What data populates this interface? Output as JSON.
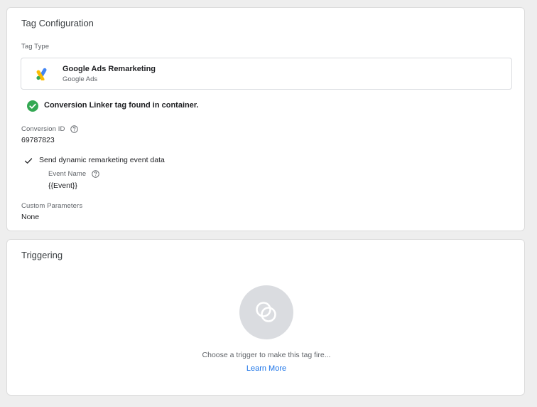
{
  "tag_configuration": {
    "title": "Tag Configuration",
    "tag_type_label": "Tag Type",
    "tag_type": {
      "name": "Google Ads Remarketing",
      "provider": "Google Ads",
      "icon": "google-ads-logo"
    },
    "linker_notice": "Conversion Linker tag found in container.",
    "conversion_id_label": "Conversion ID",
    "conversion_id_value": "69787823",
    "dynamic_remarketing_label": "Send dynamic remarketing event data",
    "event_name_label": "Event Name",
    "event_name_value": "{{Event}}",
    "custom_parameters_label": "Custom Parameters",
    "custom_parameters_value": "None"
  },
  "triggering": {
    "title": "Triggering",
    "empty_text": "Choose a trigger to make this tag fire...",
    "learn_more": "Learn More"
  },
  "colors": {
    "success": "#34a853",
    "link": "#1a73e8",
    "ads_blue": "#4285f4",
    "ads_yellow": "#fbbc04",
    "ads_green": "#34a853"
  }
}
